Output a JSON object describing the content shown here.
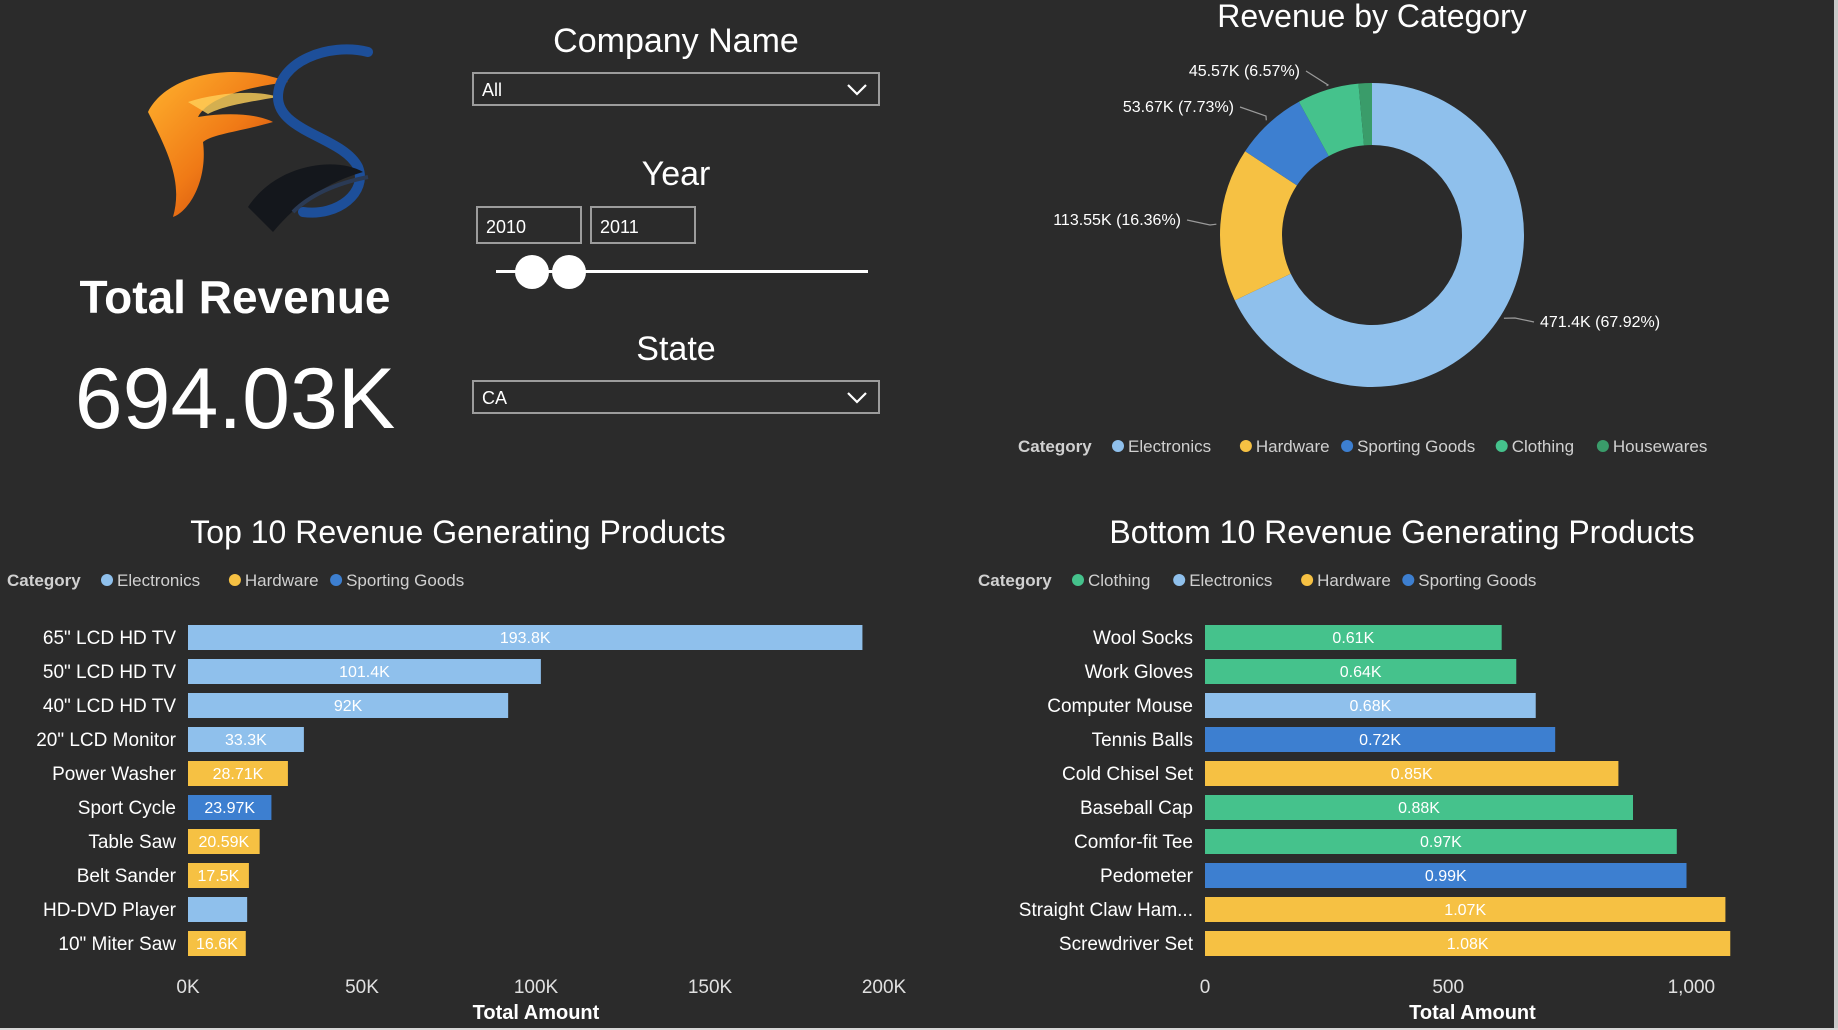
{
  "kpi": {
    "label": "Total Revenue",
    "value": "694.03K"
  },
  "slicers": {
    "company": {
      "title": "Company Name",
      "selected": "All"
    },
    "year": {
      "title": "Year",
      "from": "2010",
      "to": "2011"
    },
    "state": {
      "title": "State",
      "selected": "CA"
    }
  },
  "colors": {
    "background": "#2b2b2b",
    "electronics": "#8fc0ec",
    "hardware": "#f6c143",
    "sporting_goods": "#3d7fd0",
    "clothing": "#45c28c",
    "housewares": "#3a9c6a"
  },
  "icons": {
    "dropdown": "chevron-down-icon",
    "logo": "fs-logo-icon"
  },
  "chart_data": [
    {
      "type": "pie",
      "variant": "donut",
      "title": "Revenue by Category",
      "legend_title": "Category",
      "legend_position": "bottom",
      "slices": [
        {
          "name": "Electronics",
          "value": 471.4,
          "label": "471.4K (67.92%)",
          "color": "#8fc0ec"
        },
        {
          "name": "Hardware",
          "value": 113.55,
          "label": "113.55K (16.36%)",
          "color": "#f6c143"
        },
        {
          "name": "Sporting Goods",
          "value": 53.67,
          "label": "53.67K (7.73%)",
          "color": "#3d7fd0"
        },
        {
          "name": "Clothing",
          "value": 45.57,
          "label": "45.57K (6.57%)",
          "color": "#45c28c"
        },
        {
          "name": "Housewares",
          "value": 9.84,
          "label": "",
          "color": "#3a9c6a"
        }
      ]
    },
    {
      "type": "bar",
      "orientation": "horizontal",
      "title": "Top 10 Revenue Generating Products",
      "xlabel": "Total Amount",
      "xlim": [
        0,
        200000
      ],
      "xticks": [
        0,
        50000,
        100000,
        150000,
        200000
      ],
      "xtick_labels": [
        "0K",
        "50K",
        "100K",
        "150K",
        "200K"
      ],
      "legend_title": "Category",
      "legend": [
        {
          "name": "Electronics",
          "color": "#8fc0ec"
        },
        {
          "name": "Hardware",
          "color": "#f6c143"
        },
        {
          "name": "Sporting Goods",
          "color": "#3d7fd0"
        }
      ],
      "bars": [
        {
          "category": "65\" LCD HD TV",
          "value": 193800,
          "label": "193.8K",
          "color": "#8fc0ec"
        },
        {
          "category": "50\" LCD HD TV",
          "value": 101400,
          "label": "101.4K",
          "color": "#8fc0ec"
        },
        {
          "category": "40\" LCD HD TV",
          "value": 92000,
          "label": "92K",
          "color": "#8fc0ec"
        },
        {
          "category": "20\" LCD Monitor",
          "value": 33300,
          "label": "33.3K",
          "color": "#8fc0ec"
        },
        {
          "category": "Power Washer",
          "value": 28710,
          "label": "28.71K",
          "color": "#f6c143"
        },
        {
          "category": "Sport Cycle",
          "value": 23970,
          "label": "23.97K",
          "color": "#3d7fd0"
        },
        {
          "category": "Table Saw",
          "value": 20590,
          "label": "20.59K",
          "color": "#f6c143"
        },
        {
          "category": "Belt Sander",
          "value": 17500,
          "label": "17.5K",
          "color": "#f6c143"
        },
        {
          "category": "HD-DVD Player",
          "value": 17000,
          "label": "",
          "color": "#8fc0ec"
        },
        {
          "category": "10\" Miter Saw",
          "value": 16600,
          "label": "16.6K",
          "color": "#f6c143"
        }
      ]
    },
    {
      "type": "bar",
      "orientation": "horizontal",
      "title": "Bottom 10 Revenue Generating Products",
      "xlabel": "Total Amount",
      "xlim": [
        0,
        1100
      ],
      "xticks": [
        0,
        500,
        1000
      ],
      "xtick_labels": [
        "0",
        "500",
        "1,000"
      ],
      "legend_title": "Category",
      "legend": [
        {
          "name": "Clothing",
          "color": "#45c28c"
        },
        {
          "name": "Electronics",
          "color": "#8fc0ec"
        },
        {
          "name": "Hardware",
          "color": "#f6c143"
        },
        {
          "name": "Sporting Goods",
          "color": "#3d7fd0"
        }
      ],
      "bars": [
        {
          "category": "Wool Socks",
          "value": 610,
          "label": "0.61K",
          "color": "#45c28c"
        },
        {
          "category": "Work Gloves",
          "value": 640,
          "label": "0.64K",
          "color": "#45c28c"
        },
        {
          "category": "Computer Mouse",
          "value": 680,
          "label": "0.68K",
          "color": "#8fc0ec"
        },
        {
          "category": "Tennis Balls",
          "value": 720,
          "label": "0.72K",
          "color": "#3d7fd0"
        },
        {
          "category": "Cold Chisel Set",
          "value": 850,
          "label": "0.85K",
          "color": "#f6c143"
        },
        {
          "category": "Baseball Cap",
          "value": 880,
          "label": "0.88K",
          "color": "#45c28c"
        },
        {
          "category": "Comfor-fit Tee",
          "value": 970,
          "label": "0.97K",
          "color": "#45c28c"
        },
        {
          "category": "Pedometer",
          "value": 990,
          "label": "0.99K",
          "color": "#3d7fd0"
        },
        {
          "category": "Straight Claw Ham...",
          "value": 1070,
          "label": "1.07K",
          "color": "#f6c143"
        },
        {
          "category": "Screwdriver Set",
          "value": 1080,
          "label": "1.08K",
          "color": "#f6c143"
        }
      ]
    }
  ]
}
